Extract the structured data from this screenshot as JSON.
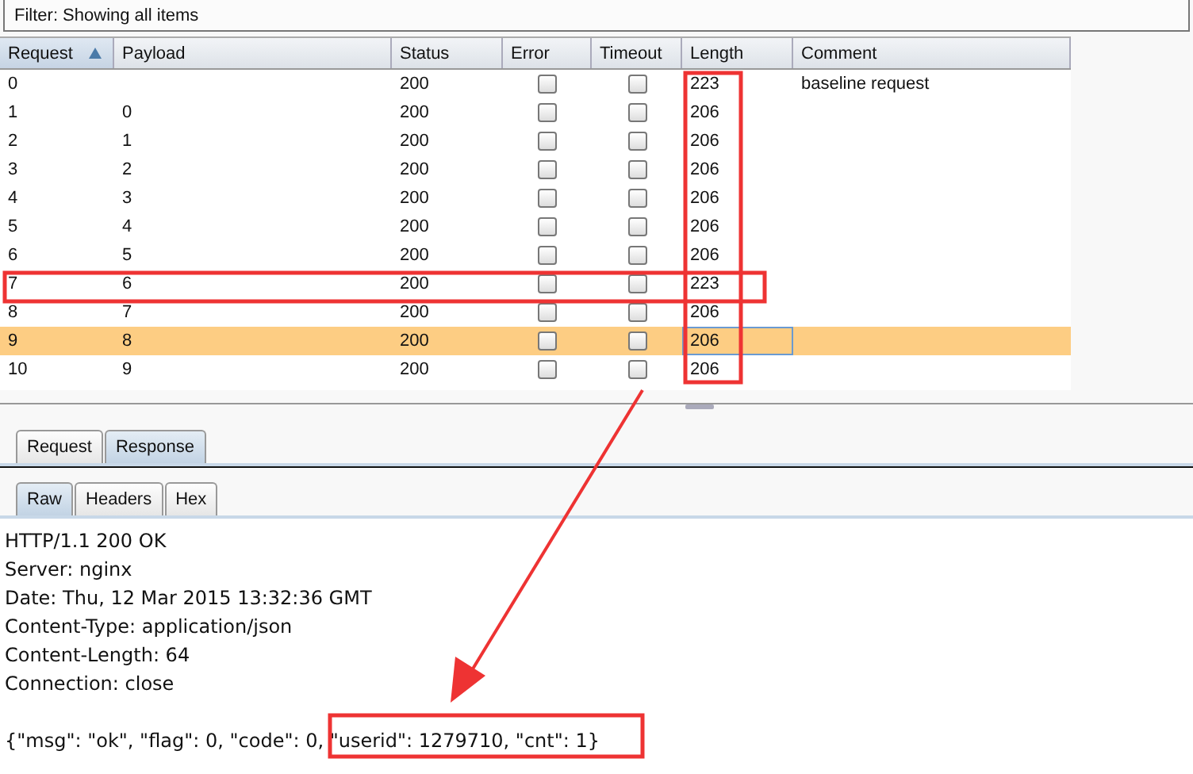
{
  "filter": {
    "text": "Filter:  Showing all items"
  },
  "table": {
    "columns": [
      {
        "label": "Request",
        "sorted": true
      },
      {
        "label": "Payload",
        "sorted": false
      },
      {
        "label": "Status",
        "sorted": false
      },
      {
        "label": "Error",
        "sorted": false
      },
      {
        "label": "Timeout",
        "sorted": false
      },
      {
        "label": "Length",
        "sorted": false
      },
      {
        "label": "Comment",
        "sorted": false
      }
    ],
    "rows": [
      {
        "request": "0",
        "payload": "",
        "status": "200",
        "error": false,
        "timeout": false,
        "length": "223",
        "comment": "baseline request",
        "selected": false
      },
      {
        "request": "1",
        "payload": "0",
        "status": "200",
        "error": false,
        "timeout": false,
        "length": "206",
        "comment": "",
        "selected": false
      },
      {
        "request": "2",
        "payload": "1",
        "status": "200",
        "error": false,
        "timeout": false,
        "length": "206",
        "comment": "",
        "selected": false
      },
      {
        "request": "3",
        "payload": "2",
        "status": "200",
        "error": false,
        "timeout": false,
        "length": "206",
        "comment": "",
        "selected": false
      },
      {
        "request": "4",
        "payload": "3",
        "status": "200",
        "error": false,
        "timeout": false,
        "length": "206",
        "comment": "",
        "selected": false
      },
      {
        "request": "5",
        "payload": "4",
        "status": "200",
        "error": false,
        "timeout": false,
        "length": "206",
        "comment": "",
        "selected": false
      },
      {
        "request": "6",
        "payload": "5",
        "status": "200",
        "error": false,
        "timeout": false,
        "length": "206",
        "comment": "",
        "selected": false
      },
      {
        "request": "7",
        "payload": "6",
        "status": "200",
        "error": false,
        "timeout": false,
        "length": "223",
        "comment": "",
        "selected": false
      },
      {
        "request": "8",
        "payload": "7",
        "status": "200",
        "error": false,
        "timeout": false,
        "length": "206",
        "comment": "",
        "selected": false
      },
      {
        "request": "9",
        "payload": "8",
        "status": "200",
        "error": false,
        "timeout": false,
        "length": "206",
        "comment": "",
        "selected": true
      },
      {
        "request": "10",
        "payload": "9",
        "status": "200",
        "error": false,
        "timeout": false,
        "length": "206",
        "comment": "",
        "selected": false
      }
    ]
  },
  "message_tabs": [
    {
      "label": "Request",
      "selected": false
    },
    {
      "label": "Response",
      "selected": true
    }
  ],
  "view_tabs": [
    {
      "label": "Raw",
      "selected": true
    },
    {
      "label": "Headers",
      "selected": false
    },
    {
      "label": "Hex",
      "selected": false
    }
  ],
  "response_headers": [
    "HTTP/1.1 200 OK",
    "Server: nginx",
    "Date: Thu, 12 Mar 2015 13:32:36 GMT",
    "Content-Type: application/json",
    "Content-Length: 64",
    "Connection: close"
  ],
  "response_body": "{\"msg\": \"ok\", \"flag\": 0, \"code\": 0, \"userid\": 1279710, \"cnt\": 1}"
}
